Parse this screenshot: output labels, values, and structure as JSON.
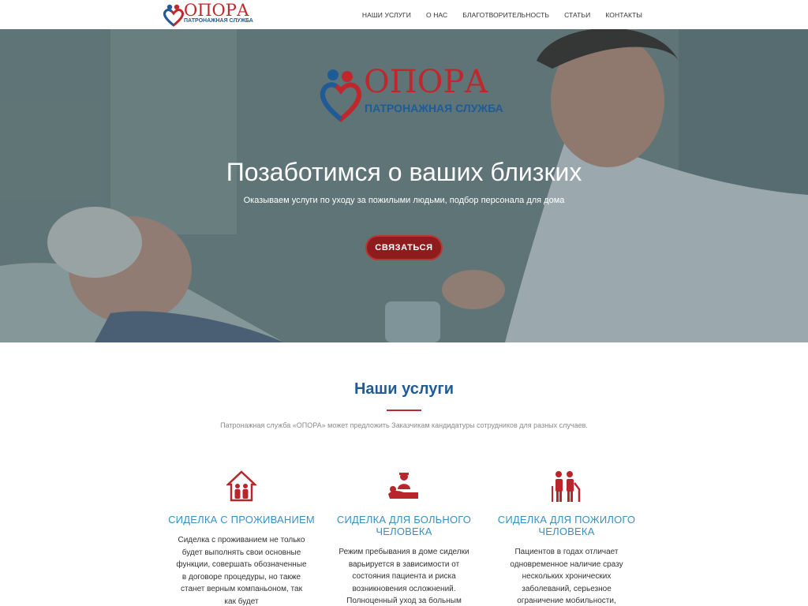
{
  "brand": {
    "name": "ОПОРА",
    "tagline": "ПАТРОНАЖНАЯ СЛУЖБА",
    "colors": {
      "red": "#c0272d",
      "blue": "#1e5b97",
      "accent_text": "#3a8fc0"
    }
  },
  "nav": {
    "items": [
      "НАШИ УСЛУГИ",
      "О НАС",
      "БЛАГОТВОРИТЕЛЬНОСТЬ",
      "СТАТЬИ",
      "КОНТАКТЫ"
    ]
  },
  "hero": {
    "title": "Позаботимся о ваших близких",
    "subtitle": "Оказываем услуги по уходу за пожилыми людьми, подбор персонала для дома",
    "button": "СВЯЗАТЬСЯ"
  },
  "services": {
    "title": "Наши услуги",
    "intro": "Патронажная служба «ОПОРА» может предложить Заказчикам кандидатуры сотрудников для разных случаев.",
    "items": [
      {
        "icon": "house-family-icon",
        "title": "СИДЕЛКА С ПРОЖИВАНИЕМ",
        "text": "Сиделка с проживанием не только будет выполнять свои основные функции, совершать обозначенные в договоре процедуры, но также станет верным компаньоном, так как будет"
      },
      {
        "icon": "nurse-patient-icon",
        "title": "СИДЕЛКА ДЛЯ БОЛЬНОГО ЧЕЛОВЕКА",
        "text": "Режим пребывания в доме сиделки варьируется в зависимости от состояния пациента и риска возникновения осложнений. Полноценный уход за больным"
      },
      {
        "icon": "elderly-couple-icon",
        "title": "СИДЕЛКА ДЛЯ ПОЖИЛОГО ЧЕЛОВЕКА",
        "text": "Пациентов в годах отличает одновременное наличие сразу нескольких хронических заболеваний, серьезное ограничение мобильности, зачастую снижение слухового и"
      }
    ]
  }
}
